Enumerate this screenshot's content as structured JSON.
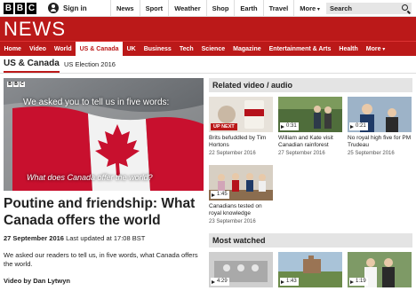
{
  "top_bar": {
    "logo_letters": [
      "B",
      "B",
      "C"
    ],
    "signin_label": "Sign in",
    "nav_items": [
      "News",
      "Sport",
      "Weather",
      "Shop",
      "Earth",
      "Travel",
      "More"
    ],
    "search_label": "Search"
  },
  "news_header": {
    "title": "NEWS"
  },
  "section_nav": {
    "items": [
      "Home",
      "Video",
      "World",
      "US & Canada",
      "UK",
      "Business",
      "Tech",
      "Science",
      "Magazine",
      "Entertainment & Arts",
      "Health",
      "More"
    ],
    "active": "US & Canada"
  },
  "sub_nav": {
    "current": "US & Canada",
    "link": "US Election 2016"
  },
  "hero": {
    "logo_letters": [
      "B",
      "B",
      "C"
    ],
    "caption_top": "We asked you to tell us in five words:",
    "caption_bottom": "What does Canada offer the world?"
  },
  "article": {
    "headline": "Poutine and friendship: What Canada offers the world",
    "date": "27 September 2016",
    "updated": "Last updated at 17:08 BST",
    "summary": "We asked our readers to tell us, in five words, what Canada offers the world.",
    "byline": "Video by Dan Lytwyn"
  },
  "related": {
    "heading": "Related video / audio",
    "cards": [
      {
        "badge": "UP NEXT",
        "duration": "",
        "title": "Brits befuddled by Tim Hortons",
        "date": "22 September 2016"
      },
      {
        "badge": "",
        "duration": "0:31",
        "title": "William and Kate visit Canadian rainforest",
        "date": "27 September 2016"
      },
      {
        "badge": "",
        "duration": "0:21",
        "title": "No royal high five for PM Trudeau",
        "date": "25 September 2016"
      },
      {
        "badge": "",
        "duration": "1:45",
        "title": "Canadians tested on royal knowledge",
        "date": "23 September 2016"
      }
    ]
  },
  "most_watched": {
    "heading": "Most watched",
    "cards": [
      {
        "duration": "4:29"
      },
      {
        "duration": "1:43"
      },
      {
        "duration": "1:19"
      }
    ]
  },
  "colors": {
    "brand_red": "#bb1919",
    "panel_grey": "#e4e4e4"
  }
}
